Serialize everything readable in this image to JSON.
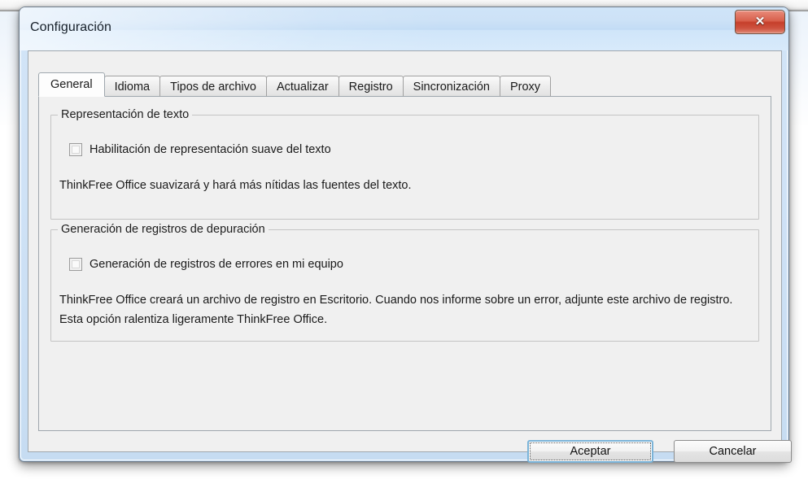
{
  "window": {
    "title": "Configuración",
    "close_icon": "close-icon",
    "close_glyph": "✕"
  },
  "tabs": [
    {
      "label": "General",
      "active": true
    },
    {
      "label": "Idioma",
      "active": false
    },
    {
      "label": "Tipos de archivo",
      "active": false
    },
    {
      "label": "Actualizar",
      "active": false
    },
    {
      "label": "Registro",
      "active": false
    },
    {
      "label": "Sincronización",
      "active": false
    },
    {
      "label": "Proxy",
      "active": false
    }
  ],
  "groups": {
    "text_rendering": {
      "title": "Representación de texto",
      "checkbox_label": "Habilitación de representación suave del texto",
      "checked": false,
      "description": "ThinkFree Office suavizará y hará más nítidas las fuentes del texto."
    },
    "debug_logging": {
      "title": "Generación de registros de depuración",
      "checkbox_label": "Generación de registros de errores en mi equipo",
      "checked": false,
      "description": "ThinkFree Office creará un archivo de registro en Escritorio. Cuando nos informe sobre un error, adjunte este archivo de registro. Esta opción ralentiza ligeramente ThinkFree Office."
    }
  },
  "buttons": {
    "accept": "Aceptar",
    "cancel": "Cancelar"
  },
  "colors": {
    "titlebar_blue": "#cde2f7",
    "close_red": "#c63f2b",
    "panel_gray": "#f0f0f0",
    "focus_blue": "#7ab3d8"
  }
}
